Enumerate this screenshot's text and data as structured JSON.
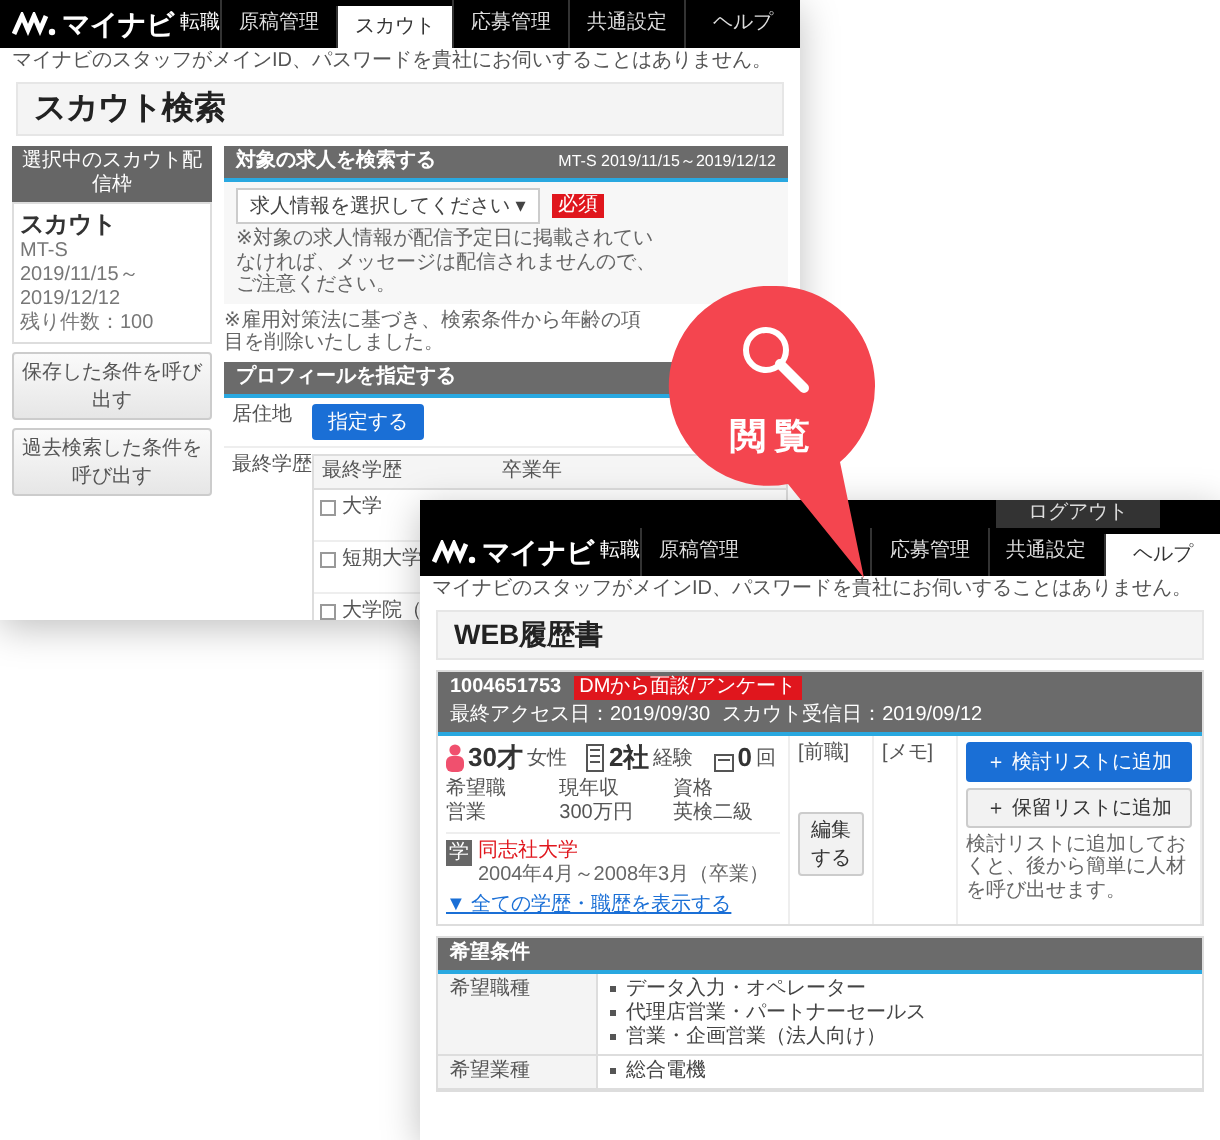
{
  "back_window": {
    "nav": {
      "logo": "マイナビ",
      "logo_sub": "転職",
      "tabs": [
        {
          "label": "原稿管理",
          "selected": false
        },
        {
          "label": "スカウト",
          "selected": true
        },
        {
          "label": "応募管理",
          "selected": false
        },
        {
          "label": "共通設定",
          "selected": false
        },
        {
          "label": "ヘルプ",
          "selected": false
        }
      ]
    },
    "notice": "マイナビのスタッフがメインID、パスワードを貴社にお伺いすることはありません。",
    "title": "スカウト検索",
    "sidebar": {
      "header": "選択中のスカウト配信枠",
      "card": {
        "name": "スカウト",
        "plan": "MT-S",
        "period": "2019/11/15～2019/12/12",
        "remaining": "残り件数：100"
      },
      "buttons": [
        "保存した条件を呼び出す",
        "過去検索した条件を呼び出す"
      ]
    },
    "search_panel": {
      "title": "対象の求人を検索する",
      "period": "MT-S 2019/11/15～2019/12/12",
      "select": "求人情報を選択してください ▾",
      "required": "必須",
      "note": "※対象の求人情報が配信予定日に掲載されていなければ、メッセージは配信されませんので、ご注意ください。"
    },
    "law_note": "※雇用対策法に基づき、検索条件から年齢の項目を削除いたしました。",
    "profile_panel": {
      "title": "プロフィールを指定する",
      "residence_label": "居住地",
      "residence_button": "指定する",
      "education_label": "最終学歴",
      "columns": [
        "最終学歴",
        "卒業年"
      ],
      "rows": [
        {
          "label": "大学",
          "checked": false
        },
        {
          "label": "短期大学",
          "checked": false
        },
        {
          "label": "大学院（",
          "checked": false
        }
      ]
    }
  },
  "front_window": {
    "logout": "ログアウト",
    "nav": {
      "logo": "マイナビ",
      "logo_sub": "転職",
      "tabs": [
        {
          "label": "原稿管理",
          "selected": false
        },
        {
          "label": "応募管理",
          "selected": false
        },
        {
          "label": "共通設定",
          "selected": false
        },
        {
          "label": "ヘルプ",
          "selected": true
        }
      ]
    },
    "notice": "マイナビのスタッフがメインID、パスワードを貴社にお伺いすることはありません。",
    "title": "WEB履歴書",
    "candidate": {
      "id": "1004651753",
      "badge": "DMから面談/アンケート",
      "meta": [
        "最終アクセス日：2019/09/30",
        "スカウト受信日：2019/09/12"
      ],
      "stats": [
        {
          "kind": "person",
          "value": "30才",
          "unit": "女性"
        },
        {
          "kind": "building",
          "value": "2社",
          "unit": "経験"
        },
        {
          "kind": "document",
          "value": "0",
          "unit": "回"
        }
      ],
      "details": [
        [
          "希望職",
          "営業"
        ],
        [
          "現年収",
          "300万円"
        ],
        [
          "資格",
          "英検二級"
        ]
      ],
      "memo_columns": [
        "[前職]",
        "[メモ]"
      ],
      "edit_button": "編集する",
      "actions": [
        {
          "kind": "primary",
          "label": "＋ 検討リストに追加"
        },
        {
          "kind": "secondary",
          "label": "＋ 保留リストに追加"
        }
      ],
      "action_note": "検討リストに追加しておくと、後から簡単に人材を呼び出せます。",
      "education": {
        "icon": "学",
        "school": "同志社大学",
        "period": "2004年4月～2008年3月（卒業）"
      },
      "more_link": "▼ 全ての学歴・職歴を表示する"
    },
    "conditions": {
      "title": "希望条件",
      "rows": [
        {
          "label": "希望職種",
          "items": [
            "データ入力・オペレーター",
            "代理店営業・パートナーセールス",
            "営業・企画営業（法人向け）"
          ]
        },
        {
          "label": "希望業種",
          "items": [
            "総合電機"
          ]
        }
      ]
    }
  },
  "bubble": {
    "label": "閲覧"
  }
}
